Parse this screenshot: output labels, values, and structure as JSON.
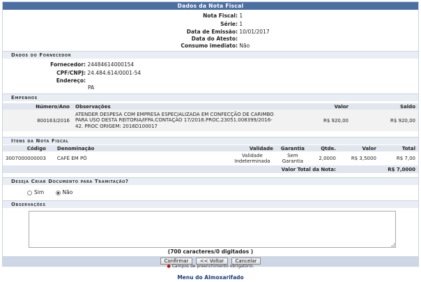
{
  "title": "Dados da Nota Fiscal",
  "nota": {
    "numero_label": "Nota Fiscal:",
    "numero": "1",
    "serie_label": "Série:",
    "serie": "1",
    "emissao_label": "Data de Emissão:",
    "emissao": "10/01/2017",
    "atesto_label": "Data do Atesto:",
    "atesto": "",
    "consumo_label": "Consumo imediato:",
    "consumo": "Não"
  },
  "fornecedor": {
    "section_title": "Dados do Fornecedor",
    "fornecedor_label": "Fornecedor:",
    "fornecedor": "24484614000154",
    "cpf_label": "CPF/CNPJ:",
    "cpf": "24.484.614/0001-54",
    "endereco_label": "Endereço:",
    "endereco": "",
    "uf": "PA"
  },
  "empenhos": {
    "section_title": "Empenhos",
    "headers": {
      "numero": "Número/Ano",
      "obs": "Observações",
      "valor": "Valor",
      "saldo": "Saldo"
    },
    "rows": [
      {
        "numero": "800163/2016",
        "obs": "ATENDER DESPESA COM EMPRESA ESPECIALIZADA EM CONFECÇÃO DE CARIMBO PARA USO DESTA REITORIA/IFPA.CONTAÇÃO 17/2016.PROC.23051.008399/2016-42. PROC ORIGEM: 2016D100017",
        "valor": "R$ 920,00",
        "saldo": "R$ 920,00"
      }
    ]
  },
  "itens": {
    "section_title": "Itens da Nota Fiscal",
    "headers": {
      "codigo": "Código",
      "denominacao": "Denominação",
      "validade": "Validade",
      "garantia": "Garantia",
      "qtde": "Qtde.",
      "valor": "Valor",
      "total": "Total"
    },
    "rows": [
      {
        "codigo": "3007000000003",
        "denominacao": "CAFÉ EM PÓ",
        "validade": "Validade Indeterminada",
        "garantia": "Sem Garantia",
        "qtde": "2,0000",
        "valor": "R$ 3,5000",
        "total": "R$ 7,00"
      }
    ],
    "total_label": "Valor Total da Nota:",
    "total_value": "R$ 7,0000"
  },
  "tramitacao": {
    "section_title": "Deseja Criar Documento para Tramitação?",
    "sim": "Sim",
    "nao": "Não",
    "selected": "nao"
  },
  "observacoes": {
    "section_title": "Observações",
    "value": "",
    "counter": "(700 caracteres/0 digitados )"
  },
  "buttons": {
    "confirmar": "Confirmar",
    "voltar": "<< Voltar",
    "cancelar": "Cancelar"
  },
  "required_note": "Campos de preenchimento obrigatório.",
  "menu_link": "Menu do Almoxarifado"
}
